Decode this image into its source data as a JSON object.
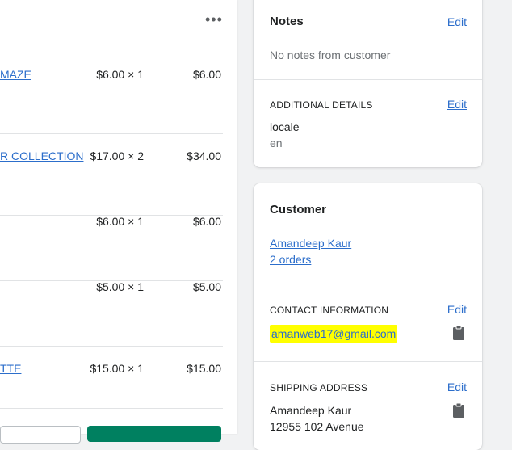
{
  "line_items": [
    {
      "name": "MAZE",
      "qty": "$6.00 × 1",
      "total": "$6.00"
    },
    {
      "name": "R COLLECTION",
      "qty": "$17.00 × 2",
      "total": "$34.00"
    },
    {
      "name": "",
      "qty": "$6.00 × 1",
      "total": "$6.00"
    },
    {
      "name": "",
      "qty": "$5.00 × 1",
      "total": "$5.00"
    },
    {
      "name": "TTE",
      "qty": "$15.00 × 1",
      "total": "$15.00"
    }
  ],
  "more_label": "•••",
  "notes": {
    "title": "Notes",
    "edit": "Edit",
    "empty_text": "No notes from customer",
    "additional_title": "ADDITIONAL DETAILS",
    "additional_edit": "Edit",
    "detail_key": "locale",
    "detail_value": "en"
  },
  "customer": {
    "title": "Customer",
    "name": "Amandeep Kaur",
    "orders": "2 orders",
    "contact_title": "CONTACT INFORMATION",
    "contact_edit": "Edit",
    "email": "amanweb17@gmail.com",
    "shipping_title": "SHIPPING ADDRESS",
    "shipping_edit": "Edit",
    "address_name": "Amandeep Kaur",
    "address_line1": "12955 102 Avenue"
  },
  "colors": {
    "link": "#2c6ecb",
    "highlight": "#ffff00",
    "primary_button": "#008060"
  },
  "icons": [
    "more-horizontal-icon",
    "clipboard-icon"
  ]
}
